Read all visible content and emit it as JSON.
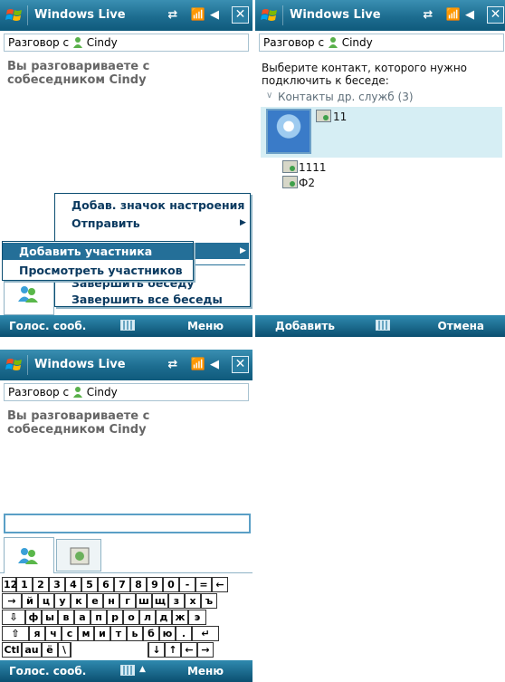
{
  "screen1": {
    "title": "Windows Live",
    "conversation_prefix": "Разговор с",
    "contact_name": "Cindy",
    "message": "Вы разговариваете с собеседником Cindy",
    "menu": {
      "items": [
        "Добав. значок настроения",
        "Отправить",
        "Завершить беседу",
        "Завершить все беседы"
      ],
      "submenu": [
        "Добавить участника",
        "Просмотреть участников"
      ]
    },
    "softkey_left": "Голос. сооб.",
    "softkey_right": "Меню"
  },
  "screen2": {
    "title": "Windows Live",
    "conversation_prefix": "Разговор с",
    "contact_name": "Cindy",
    "instruction": "Выберите контакт, которого нужно подключить к беседе:",
    "group_label": "Контакты др. служб (3)",
    "contacts": [
      "11",
      "1111",
      "Ф2"
    ],
    "softkey_left": "Добавить",
    "softkey_right": "Отмена"
  },
  "screen3": {
    "title": "Windows Live",
    "conversation_prefix": "Разговор с",
    "contact_name": "Cindy",
    "message": "Вы разговариваете с собеседником Cindy",
    "keyboard": {
      "row1": [
        "123",
        "1",
        "2",
        "3",
        "4",
        "5",
        "6",
        "7",
        "8",
        "9",
        "0",
        "-",
        "=",
        "←"
      ],
      "row2": [
        "→",
        "й",
        "ц",
        "у",
        "к",
        "е",
        "н",
        "г",
        "ш",
        "щ",
        "з",
        "х",
        "ъ"
      ],
      "row3": [
        "⇩",
        "ф",
        "ы",
        "в",
        "а",
        "п",
        "р",
        "о",
        "л",
        "д",
        "ж",
        "э"
      ],
      "row4": [
        "⇧",
        "я",
        "ч",
        "с",
        "м",
        "и",
        "т",
        "ь",
        "б",
        "ю",
        ".",
        "↵"
      ],
      "row5": [
        "Ctl",
        "au",
        "ё",
        "\\",
        " ",
        "↓",
        "↑",
        "←",
        "→"
      ]
    },
    "softkey_left": "Голос. сооб.",
    "softkey_right": "Меню"
  },
  "colors": {
    "titlebar": "#1d6d90",
    "highlight": "#246f98",
    "selection": "#d6eef4",
    "text_muted": "#666666"
  }
}
